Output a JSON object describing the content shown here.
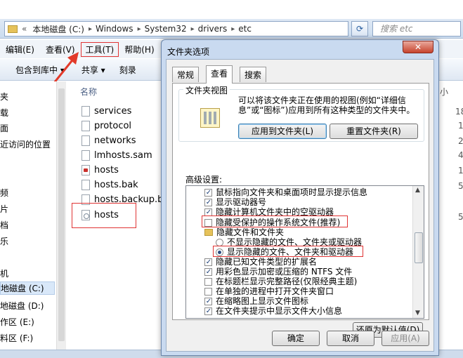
{
  "explorer": {
    "breadcrumbs": [
      "本地磁盘 (C:)",
      "Windows",
      "System32",
      "drivers",
      "etc"
    ],
    "search_placeholder": "搜索 etc",
    "menu": [
      "编辑(E)",
      "查看(V)",
      "工具(T)",
      "帮助(H)"
    ],
    "toolbar": [
      "包含到库中 ▾",
      "共享 ▾",
      "刻录"
    ],
    "nav_items": [
      "夹",
      "载",
      "面",
      "近访问的位置",
      "频",
      "片",
      "档",
      "乐",
      "机",
      "地磁盘 (C:)",
      "地磁盘 (D:)",
      "作区 (E:)",
      "料区 (F:)"
    ],
    "column_name": "名称",
    "files": [
      {
        "name": "services",
        "icon": "file-icon"
      },
      {
        "name": "protocol",
        "icon": "file-icon"
      },
      {
        "name": "networks",
        "icon": "file-icon"
      },
      {
        "name": "lmhosts.sam",
        "icon": "file-icon"
      },
      {
        "name": "hosts",
        "icon": "red-file-icon"
      },
      {
        "name": "hosts.bak",
        "icon": "file-icon"
      },
      {
        "name": "hosts.backup.bak",
        "icon": "file-icon"
      },
      {
        "name": "hosts",
        "icon": "system-file-icon"
      }
    ],
    "right_glyphs": [
      "小",
      "18",
      "1",
      "2",
      "4",
      "1",
      "5",
      "5"
    ]
  },
  "dialog": {
    "title": "文件夹选项",
    "close_label": "✕",
    "tabs": [
      "常规",
      "查看",
      "搜索"
    ],
    "folder_view": {
      "group_title": "文件夹视图",
      "description": "可以将该文件夹正在使用的视图(例如“详细信息”或“图标”)应用到所有这种类型的文件夹中。",
      "apply_button": "应用到文件夹(L)",
      "reset_button": "重置文件夹(R)"
    },
    "advanced_label": "高级设置:",
    "advanced_items": [
      {
        "type": "checkbox",
        "checked": true,
        "label": "鼠标指向文件夹和桌面项时显示提示信息"
      },
      {
        "type": "checkbox",
        "checked": true,
        "label": "显示驱动器号"
      },
      {
        "type": "checkbox",
        "checked": true,
        "label": "隐藏计算机文件夹中的空驱动器"
      },
      {
        "type": "checkbox",
        "checked": false,
        "label": "隐藏受保护的操作系统文件(推荐)"
      },
      {
        "type": "folder",
        "label": "隐藏文件和文件夹"
      },
      {
        "type": "radio",
        "checked": false,
        "label": "不显示隐藏的文件、文件夹或驱动器"
      },
      {
        "type": "radio",
        "checked": true,
        "label": "显示隐藏的文件、文件夹和驱动器"
      },
      {
        "type": "checkbox",
        "checked": true,
        "label": "隐藏已知文件类型的扩展名"
      },
      {
        "type": "checkbox",
        "checked": true,
        "label": "用彩色显示加密或压缩的 NTFS 文件"
      },
      {
        "type": "checkbox",
        "checked": false,
        "label": "在标题栏显示完整路径(仅限经典主题)"
      },
      {
        "type": "checkbox",
        "checked": false,
        "label": "在单独的进程中打开文件夹窗口"
      },
      {
        "type": "checkbox",
        "checked": true,
        "label": "在缩略图上显示文件图标"
      },
      {
        "type": "checkbox",
        "checked": true,
        "label": "在文件夹提示中显示文件大小信息"
      }
    ],
    "restore_button": "还原为默认值(D)",
    "ok_button": "确定",
    "cancel_button": "取消",
    "apply_button": "应用(A)"
  }
}
